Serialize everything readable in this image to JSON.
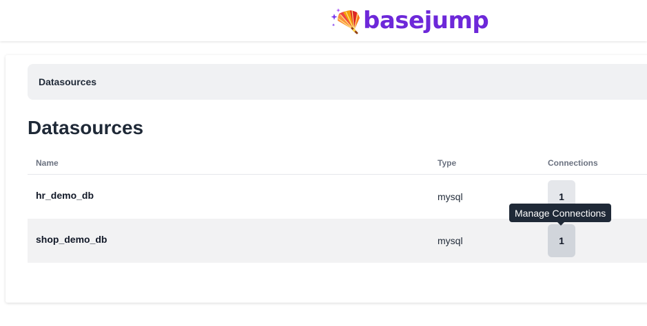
{
  "header": {
    "logo_text": "basejump",
    "logo_icon": "folding-fan-sparkles-icon",
    "brand_color": "#6d28d9"
  },
  "breadcrumb": {
    "items": [
      "Datasources"
    ]
  },
  "page": {
    "title": "Datasources"
  },
  "table": {
    "columns": [
      "Name",
      "Type",
      "Connections"
    ],
    "rows": [
      {
        "name": "hr_demo_db",
        "type": "mysql",
        "connections": "1"
      },
      {
        "name": "shop_demo_db",
        "type": "mysql",
        "connections": "1"
      }
    ]
  },
  "tooltip": {
    "text": "Manage Connections"
  }
}
